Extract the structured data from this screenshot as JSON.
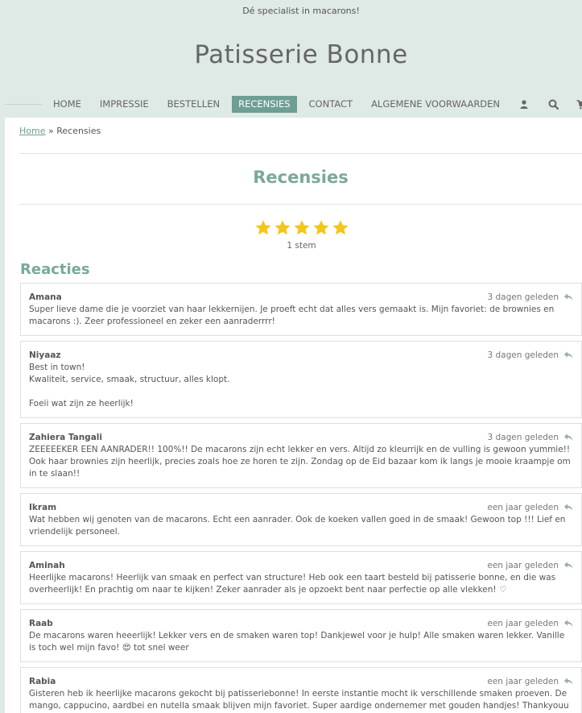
{
  "header": {
    "tagline": "Dé specialist in macarons!",
    "title": "Patisserie Bonne"
  },
  "nav": {
    "items": [
      {
        "label": "HOME"
      },
      {
        "label": "IMPRESSIE"
      },
      {
        "label": "BESTELLEN"
      },
      {
        "label": "RECENSIES",
        "active": true
      },
      {
        "label": "CONTACT"
      },
      {
        "label": "ALGEMENE VOORWAARDEN"
      }
    ],
    "icons": [
      "user-icon",
      "search-icon",
      "cart-icon"
    ]
  },
  "breadcrumb": {
    "home": "Home",
    "separator": "»",
    "current": "Recensies"
  },
  "page": {
    "heading": "Recensies",
    "rating_stars": 5,
    "votes": "1 stem",
    "comments_heading": "Reacties"
  },
  "colors": {
    "accent": "#6f9e93",
    "header_bg": "#dfe9e6",
    "star": "#f5c518"
  },
  "reviews": [
    {
      "author": "Amana",
      "time": "3 dagen geleden",
      "text": "Super lieve dame die je voorziet van haar lekkernijen. Je proeft echt dat alles vers gemaakt is. Mijn favoriet: de brownies en macarons :). Zeer professioneel en zeker een aanraderrrr!"
    },
    {
      "author": "Niyaaz",
      "time": "3 dagen geleden",
      "text": "Best in town!\nKwaliteit, service, smaak, structuur, alles klopt.\n\nFoeii wat zijn ze heerlijk!"
    },
    {
      "author": "Zahiera Tangali",
      "time": "3 dagen geleden",
      "text": "ZEEEEEKER EEN AANRADER!! 100%!! De macarons zijn echt lekker en vers. Altijd zo kleurrijk en de vulling is gewoon yummie!! Ook haar brownies zijn heerlijk, precies zoals hoe ze horen te zijn. Zondag op de Eid bazaar kom ik langs je mooie kraampje om in te slaan!!"
    },
    {
      "author": "Ikram",
      "time": "een jaar geleden",
      "text": "Wat hebben wij genoten van de macarons. Echt een aanrader. Ook de koeken vallen goed in de smaak! Gewoon top !!! Lief en vriendelijk personeel."
    },
    {
      "author": "Aminah",
      "time": "een jaar geleden",
      "text": "Heerlijke macarons! Heerlijk van smaak en perfect van structure! Heb ook een taart besteld bij patisserie bonne, en die was overheerlijk! En prachtig om naar te kijken! Zeker aanrader als je opzoekt bent naar perfectie op alle vlekken! ♡"
    },
    {
      "author": "Raab",
      "time": "een jaar geleden",
      "text": "De macarons waren heeerlijk! Lekker vers en de smaken waren top! Dankjewel voor je hulp! Alle smaken waren lekker. Vanille is toch wel mijn favo! 😍 tot snel weer"
    },
    {
      "author": "Rabia",
      "time": "een jaar geleden",
      "text": "Gisteren heb ik heerlijke macarons gekocht bij patisseriebonne! In eerste instantie mocht ik verschillende smaken proeven. De mango, cappucino, aardbei en nutella smaak blijven mijn favoriet. Super aardige ondernemer met gouden handjes! Thankyouu"
    }
  ]
}
